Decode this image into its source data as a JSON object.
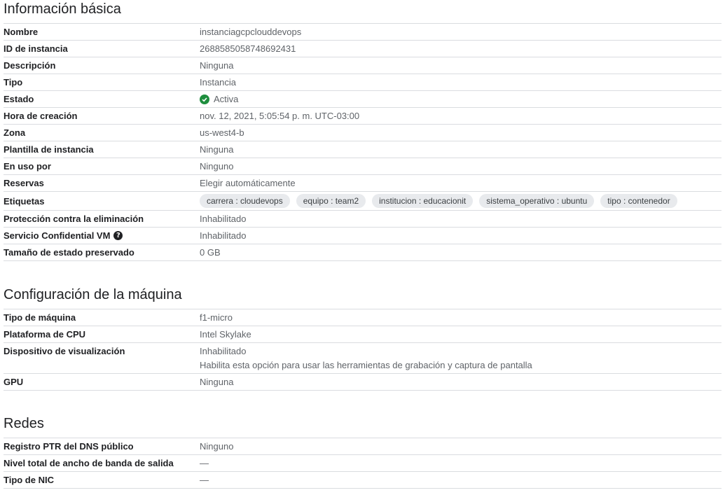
{
  "basic": {
    "title": "Información básica",
    "rows": [
      {
        "key": "Nombre",
        "value": "instanciagcpclouddevops"
      },
      {
        "key": "ID de instancia",
        "value": "2688585058748692431"
      },
      {
        "key": "Descripción",
        "value": "Ninguna"
      },
      {
        "key": "Tipo",
        "value": "Instancia"
      },
      {
        "key": "Estado",
        "value": "Activa"
      },
      {
        "key": "Hora de creación",
        "value": "nov. 12, 2021, 5:05:54 p. m. UTC-03:00"
      },
      {
        "key": "Zona",
        "value": "us-west4-b"
      },
      {
        "key": "Plantilla de instancia",
        "value": "Ninguna"
      },
      {
        "key": "En uso por",
        "value": "Ninguno"
      },
      {
        "key": "Reservas",
        "value": "Elegir automáticamente"
      },
      {
        "key": "Etiquetas",
        "chips": [
          "carrera : cloudevops",
          "equipo : team2",
          "institucion : educacionit",
          "sistema_operativo : ubuntu",
          "tipo : contenedor"
        ]
      },
      {
        "key": "Protección contra la eliminación",
        "value": "Inhabilitado"
      },
      {
        "key": "Servicio Confidential VM",
        "value": "Inhabilitado"
      },
      {
        "key": "Tamaño de estado preservado",
        "value": "0 GB"
      }
    ]
  },
  "machine": {
    "title": "Configuración de la máquina",
    "rows": [
      {
        "key": "Tipo de máquina",
        "value": "f1-micro"
      },
      {
        "key": "Plataforma de CPU",
        "value": "Intel Skylake"
      },
      {
        "key": "Dispositivo de visualización",
        "value": "Inhabilitado",
        "sub": "Habilita esta opción para usar las herramientas de grabación y captura de pantalla"
      },
      {
        "key": "GPU",
        "value": "Ninguna"
      }
    ]
  },
  "network": {
    "title": "Redes",
    "rows": [
      {
        "key": "Registro PTR del DNS público",
        "value": "Ninguno"
      },
      {
        "key": "Nivel total de ancho de banda de salida",
        "value": "—"
      },
      {
        "key": "Tipo de NIC",
        "value": "—"
      }
    ]
  },
  "colors": {
    "status_ok": "#1e8e3e",
    "chip_bg": "#e8eaed",
    "divider": "#dadce0"
  },
  "icons": {
    "status": "check-circle-icon",
    "help": "help-icon"
  }
}
